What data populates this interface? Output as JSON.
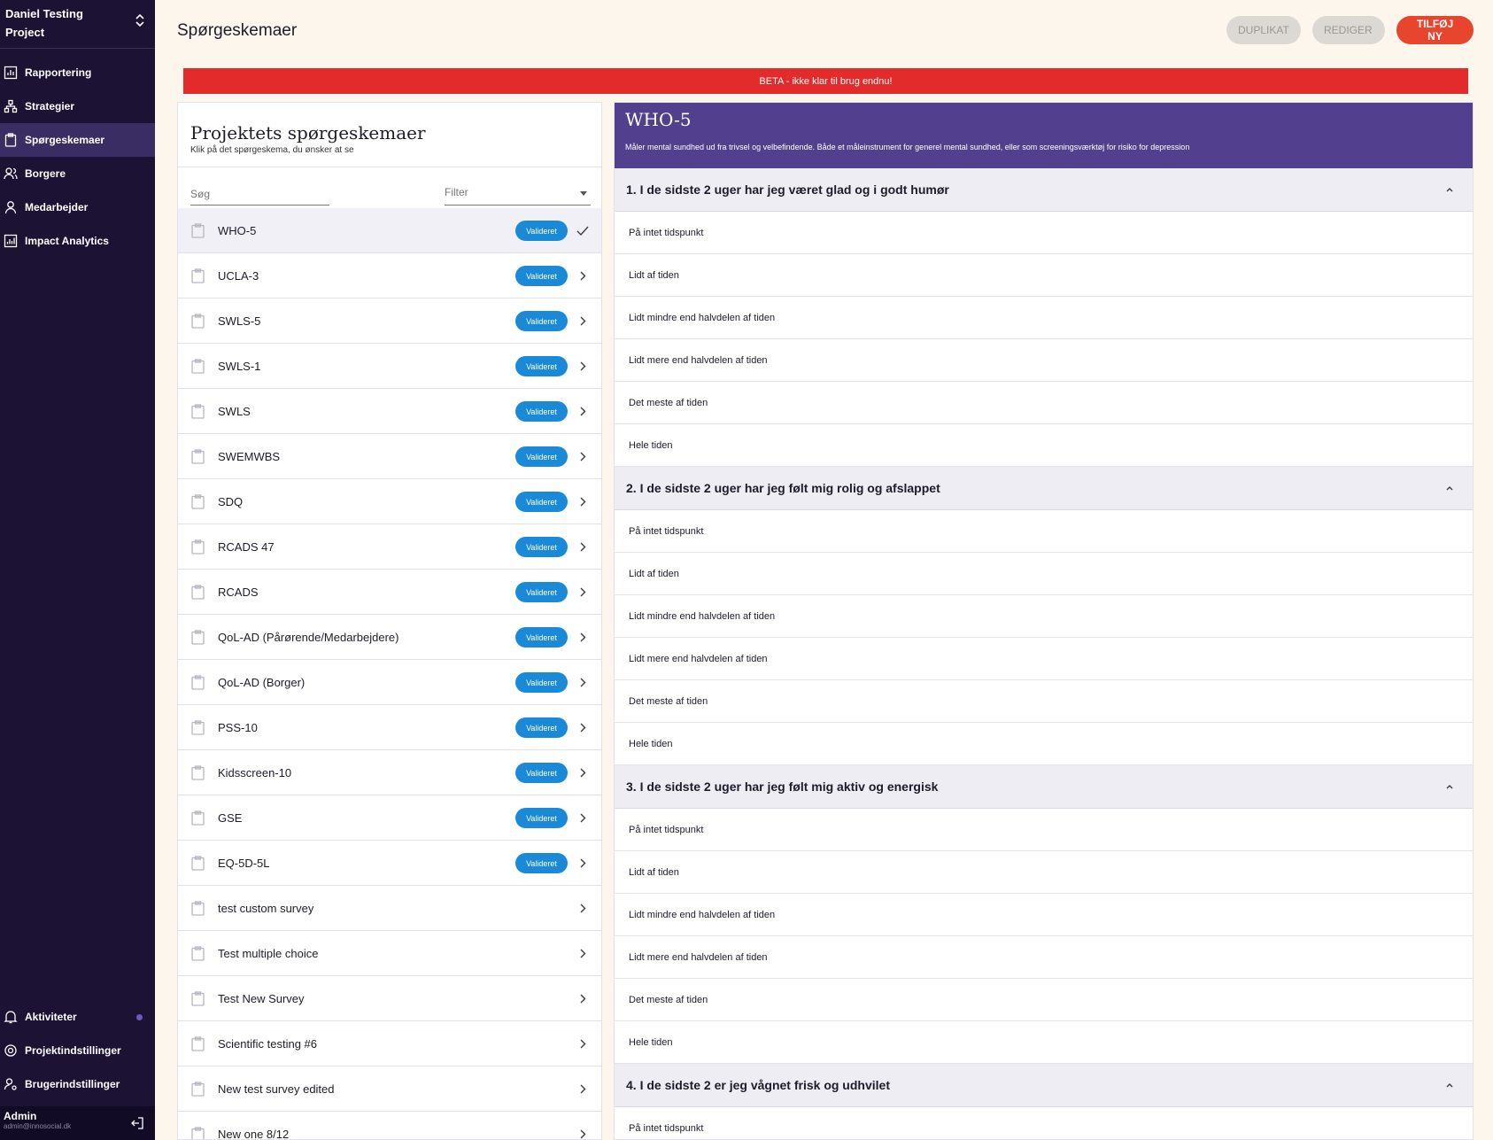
{
  "project": {
    "name": "Daniel Testing Project"
  },
  "nav": {
    "items": [
      {
        "label": "Rapportering",
        "icon": "chart-icon"
      },
      {
        "label": "Strategier",
        "icon": "hierarchy-icon"
      },
      {
        "label": "Spørgeskemaer",
        "icon": "clipboard-icon",
        "active": true
      },
      {
        "label": "Borgere",
        "icon": "users-icon"
      },
      {
        "label": "Medarbejder",
        "icon": "user-icon"
      },
      {
        "label": "Impact Analytics",
        "icon": "analytics-icon"
      }
    ],
    "bottom": [
      {
        "label": "Aktiviteter",
        "icon": "bell-icon"
      },
      {
        "label": "Projektindstillinger",
        "icon": "gear-icon"
      },
      {
        "label": "Brugerindstillinger",
        "icon": "user-settings-icon"
      }
    ]
  },
  "user": {
    "name": "Admin",
    "email": "admin@innosocial.dk"
  },
  "header": {
    "title": "Spørgeskemaer",
    "duplicate_label": "DUPLIKAT",
    "edit_label": "REDIGER",
    "add_label": "TILFØJ NY"
  },
  "beta_banner": "BETA - ikke klar til brug endnu!",
  "list_panel": {
    "title": "Projektets spørgeskemaer",
    "subtitle": "Klik på det spørgeskema, du ønsker at se",
    "search_placeholder": "Søg",
    "filter_placeholder": "Filter",
    "badge_label": "Valideret",
    "items": [
      {
        "name": "WHO-5",
        "validated": true,
        "selected": true
      },
      {
        "name": "UCLA-3",
        "validated": true
      },
      {
        "name": "SWLS-5",
        "validated": true
      },
      {
        "name": "SWLS-1",
        "validated": true
      },
      {
        "name": "SWLS",
        "validated": true
      },
      {
        "name": "SWEMWBS",
        "validated": true
      },
      {
        "name": "SDQ",
        "validated": true
      },
      {
        "name": "RCADS 47",
        "validated": true
      },
      {
        "name": "RCADS",
        "validated": true
      },
      {
        "name": "QoL-AD (Pårørende/Medarbejdere)",
        "validated": true
      },
      {
        "name": "QoL-AD (Borger)",
        "validated": true
      },
      {
        "name": "PSS-10",
        "validated": true
      },
      {
        "name": "Kidsscreen-10",
        "validated": true
      },
      {
        "name": "GSE",
        "validated": true
      },
      {
        "name": "EQ-5D-5L",
        "validated": true
      },
      {
        "name": "test custom survey",
        "validated": false
      },
      {
        "name": "Test multiple choice",
        "validated": false
      },
      {
        "name": "Test New Survey",
        "validated": false
      },
      {
        "name": "Scientific testing #6",
        "validated": false
      },
      {
        "name": "New test survey edited",
        "validated": false
      },
      {
        "name": "New one 8/12",
        "validated": false
      }
    ]
  },
  "detail": {
    "title": "WHO-5",
    "description": "Måler mental sundhed ud fra trivsel og velbefindende. Både et måleinstrument for generel mental sundhed, eller som screeningsværktøj for risiko for depression",
    "questions": [
      {
        "label": "1. I de sidste 2 uger har jeg været glad og i godt humør",
        "options": [
          "På intet tidspunkt",
          "Lidt af tiden",
          "Lidt mindre end halvdelen af tiden",
          "Lidt mere end halvdelen af tiden",
          "Det meste af tiden",
          "Hele tiden"
        ]
      },
      {
        "label": "2. I de sidste 2 uger har jeg følt mig rolig og afslappet",
        "options": [
          "På intet tidspunkt",
          "Lidt af tiden",
          "Lidt mindre end halvdelen af tiden",
          "Lidt mere end halvdelen af tiden",
          "Det meste af tiden",
          "Hele tiden"
        ]
      },
      {
        "label": "3. I de sidste 2 uger har jeg følt mig aktiv og energisk",
        "options": [
          "På intet tidspunkt",
          "Lidt af tiden",
          "Lidt mindre end halvdelen af tiden",
          "Lidt mere end halvdelen af tiden",
          "Det meste af tiden",
          "Hele tiden"
        ]
      },
      {
        "label": "4. I de sidste 2 er jeg vågnet frisk og udhvilet",
        "options": [
          "På intet tidspunkt"
        ]
      }
    ]
  },
  "colors": {
    "sidebar": "#1b1234",
    "accent": "#e8452f",
    "header_purple": "#52408f",
    "badge": "#1a8ad8",
    "beta": "#e32b2b"
  }
}
